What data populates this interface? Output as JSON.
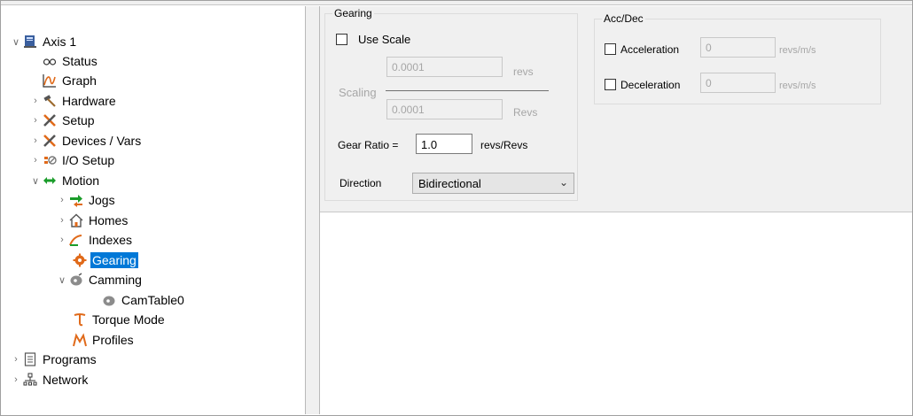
{
  "tree": {
    "axis": "Axis 1",
    "status": "Status",
    "graph": "Graph",
    "hardware": "Hardware",
    "setup": "Setup",
    "devices": "Devices / Vars",
    "io_setup": "I/O Setup",
    "motion": "Motion",
    "jogs": "Jogs",
    "homes": "Homes",
    "indexes": "Indexes",
    "gearing": "Gearing",
    "camming": "Camming",
    "camtable": "CamTable0",
    "torque_mode": "Torque Mode",
    "profiles": "Profiles",
    "programs": "Programs",
    "network": "Network"
  },
  "gearing": {
    "group_title": "Gearing",
    "use_scale_label": "Use Scale",
    "use_scale_checked": false,
    "scaling_label": "Scaling",
    "numerator_value": "0.0001",
    "numerator_unit": "revs",
    "denominator_value": "0.0001",
    "denominator_unit": "Revs",
    "gear_ratio_label": "Gear Ratio =",
    "gear_ratio_value": "1.0",
    "gear_ratio_unit": "revs/Revs",
    "direction_label": "Direction",
    "direction_value": "Bidirectional"
  },
  "accdec": {
    "group_title": "Acc/Dec",
    "acceleration_label": "Acceleration",
    "acceleration_value": "0",
    "acceleration_unit": "revs/m/s",
    "deceleration_label": "Deceleration",
    "deceleration_value": "0",
    "deceleration_unit": "revs/m/s"
  },
  "colors": {
    "selection": "#0078d7",
    "panel_bg": "#f0f0f0",
    "motion_green": "#1a9c2a",
    "orange": "#e06a1a"
  }
}
